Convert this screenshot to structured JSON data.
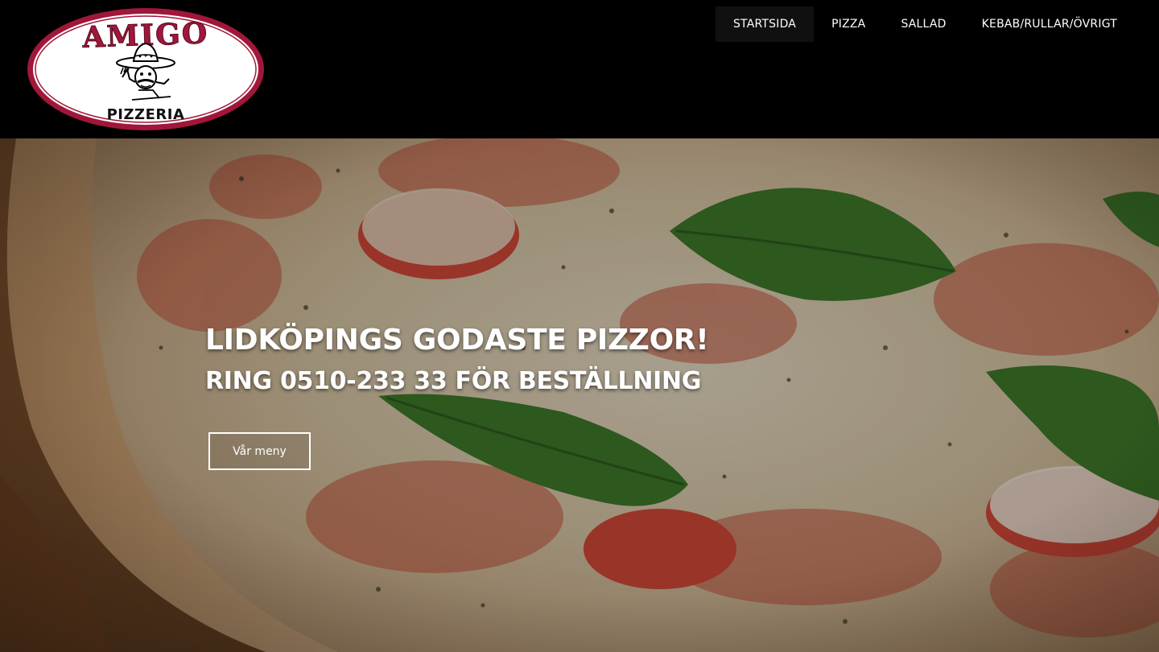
{
  "logo": {
    "brand": "AMIGO",
    "tagline": "PIZZERIA"
  },
  "nav": {
    "items": [
      {
        "label": "STARTSIDA",
        "active": true
      },
      {
        "label": "PIZZA"
      },
      {
        "label": "SALLAD"
      },
      {
        "label": "KEBAB/RULLAR/ÖVRIGT"
      }
    ]
  },
  "hero": {
    "title": "LIDKÖPINGS GODASTE PIZZOR!",
    "subtitle": "RING 0510-233 33 FÖR BESTÄLLNING",
    "button_label": "Vår meny"
  },
  "colors": {
    "header_bg": "#000000",
    "logo_ring": "#a0173a",
    "nav_active_bg": "#101010",
    "text": "#ffffff"
  }
}
